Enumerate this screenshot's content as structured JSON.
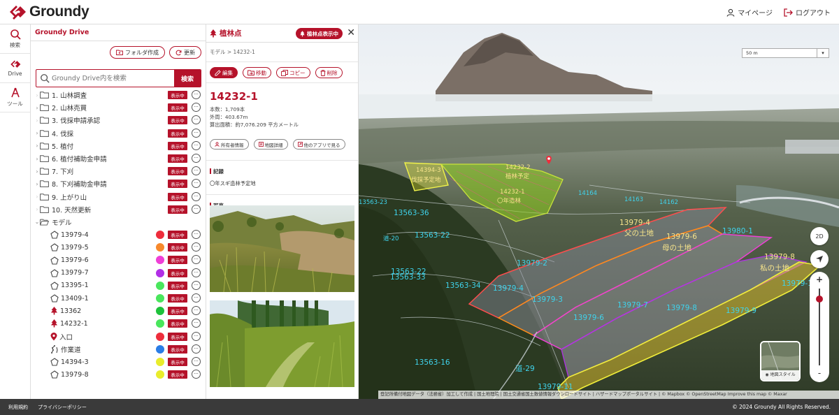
{
  "header": {
    "brand": "Groundy",
    "mypage_label": "マイページ",
    "logout_label": "ログアウト"
  },
  "rail": [
    {
      "label": "検索",
      "icon": "search-icon"
    },
    {
      "label": "Drive",
      "icon": "drive-icon"
    },
    {
      "label": "ツール",
      "icon": "tools-icon"
    }
  ],
  "drive": {
    "title": "Groundy Drive",
    "new_folder_label": "フォルダ作成",
    "refresh_label": "更新",
    "search_placeholder": "Groundy Drive内を検索",
    "search_button": "検索",
    "status_badge": "表示中",
    "folders": [
      {
        "name": "1. 山林調査",
        "badge": true
      },
      {
        "name": "2. 山林売買",
        "badge": true
      },
      {
        "name": "3. 伐採申請承認",
        "badge": true
      },
      {
        "name": "4. 伐採",
        "badge": true
      },
      {
        "name": "5. 植付",
        "badge": true
      },
      {
        "name": "6. 植付補助金申請",
        "badge": true
      },
      {
        "name": "7. 下刈",
        "badge": true
      },
      {
        "name": "8. 下刈補助金申請",
        "badge": true
      },
      {
        "name": "9. 上がり山",
        "badge": true
      },
      {
        "name": "10. 天然更新",
        "badge": true
      }
    ],
    "model_folder": "モデル",
    "models": [
      {
        "name": "13979-4",
        "icon": "polygon-icon",
        "color": "#ee2d3c"
      },
      {
        "name": "13979-5",
        "icon": "polygon-icon",
        "color": "#f7892c"
      },
      {
        "name": "13979-6",
        "icon": "polygon-icon",
        "color": "#ef3fd6"
      },
      {
        "name": "13979-7",
        "icon": "polygon-icon",
        "color": "#b12fe6"
      },
      {
        "name": "13395-1",
        "icon": "polygon-icon",
        "color": "#49e65c"
      },
      {
        "name": "13409-1",
        "icon": "polygon-icon",
        "color": "#49e65c"
      },
      {
        "name": "13362",
        "icon": "tree-icon",
        "color": "#1ec23b"
      },
      {
        "name": "14232-1",
        "icon": "tree-icon",
        "color": "#49e65c"
      },
      {
        "name": "入口",
        "icon": "pin-icon",
        "color": "#ee2d3c"
      },
      {
        "name": "作業道",
        "icon": "path-icon",
        "color": "#2a7de6"
      },
      {
        "name": "14394-3",
        "icon": "polygon-icon",
        "color": "#e9ec2c"
      },
      {
        "name": "13979-8",
        "icon": "polygon-icon",
        "color": "#e9ec2c"
      }
    ]
  },
  "detail": {
    "title": "植林点",
    "status_pill": "植林点表示中",
    "breadcrumb": "モデル > 14232-1",
    "actions": {
      "edit": "編集",
      "move": "移動",
      "copy": "コピー",
      "delete": "削除"
    },
    "feature_id": "14232-1",
    "stats": [
      "本数：1,709本",
      "外周：403.67m",
      "算出面積：約7,076.209 平方メートル"
    ],
    "links": {
      "owner": "所有者情報",
      "map": "地図詳細",
      "other_app": "他のアプリで見る"
    },
    "record_title": "記録",
    "record_text": "〇年スギ造林予定地",
    "photos_title": "写真"
  },
  "map": {
    "scale_label": "50 m",
    "btn_2d": "2D",
    "zoom_plus": "+",
    "zoom_minus": "-",
    "style_label": "地図スタイル",
    "attribution": "登記所備付地図データ（法務省）加工して作成 | 国土地理院 | 国土交通省国土数値情報ダウンロードサイト | ハザードマップポータルサイト | © Mapbox © OpenStreetMap Improve this map © Maxar",
    "labels": [
      {
        "text": "14394-3",
        "kind": "y"
      },
      {
        "text": "伐採予定地",
        "kind": "y"
      },
      {
        "text": "14232-2",
        "kind": "y"
      },
      {
        "text": "植林予定",
        "kind": "y"
      },
      {
        "text": "14232-1",
        "kind": "y"
      },
      {
        "text": "〇年造林",
        "kind": "y"
      },
      {
        "text": "13979-4",
        "kind": "y"
      },
      {
        "text": "父の土地",
        "kind": "y"
      },
      {
        "text": "13979-6",
        "kind": "y"
      },
      {
        "text": "母の土地",
        "kind": "y"
      },
      {
        "text": "13979-8",
        "kind": "y"
      },
      {
        "text": "私の土地",
        "kind": "y"
      },
      {
        "text": "13563-36",
        "kind": "c"
      },
      {
        "text": "13563-22",
        "kind": "c"
      },
      {
        "text": "13563-22",
        "kind": "c"
      },
      {
        "text": "13563-33",
        "kind": "c"
      },
      {
        "text": "13563-34",
        "kind": "c"
      },
      {
        "text": "13979-2",
        "kind": "c"
      },
      {
        "text": "13979-4",
        "kind": "c"
      },
      {
        "text": "13979-3",
        "kind": "c"
      },
      {
        "text": "13979-6",
        "kind": "c"
      },
      {
        "text": "13979-7",
        "kind": "c"
      },
      {
        "text": "13979-8",
        "kind": "c"
      },
      {
        "text": "13979-9",
        "kind": "c"
      },
      {
        "text": "13979-1",
        "kind": "c"
      },
      {
        "text": "13980-1",
        "kind": "c"
      },
      {
        "text": "13563-16",
        "kind": "c"
      },
      {
        "text": "13563-23",
        "kind": "c"
      },
      {
        "text": "14163",
        "kind": "c"
      },
      {
        "text": "14162",
        "kind": "c"
      },
      {
        "text": "14164",
        "kind": "c"
      },
      {
        "text": "道-20",
        "kind": "c"
      },
      {
        "text": "道-29",
        "kind": "c"
      },
      {
        "text": "13979-11",
        "kind": "c"
      }
    ]
  },
  "footer": {
    "terms": "利用規約",
    "privacy": "プライバシーポリシー",
    "copyright": "© 2024 Groundy All Rights Reserved."
  }
}
